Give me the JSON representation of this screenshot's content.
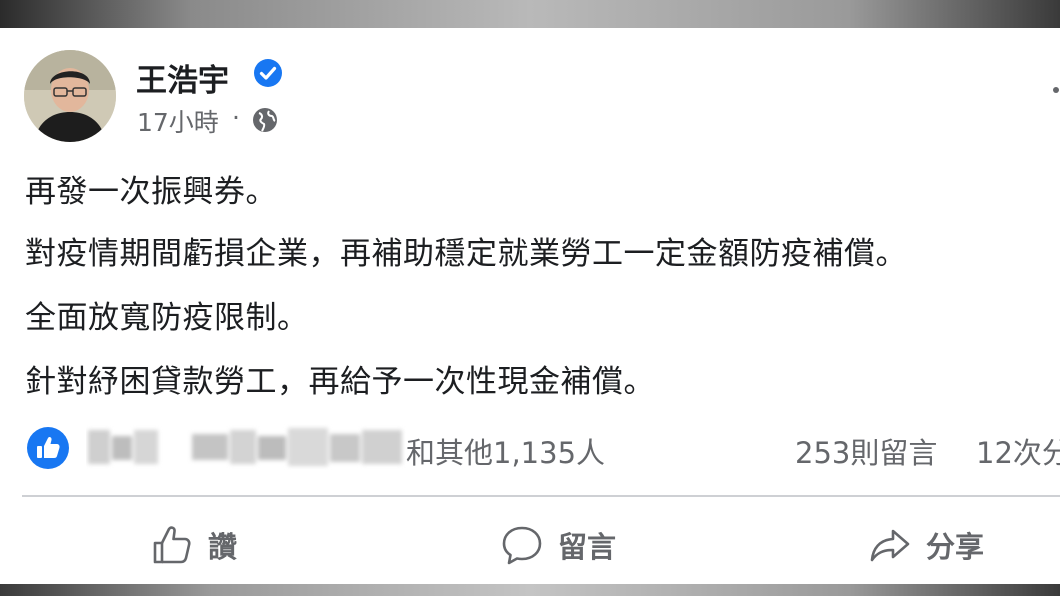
{
  "post": {
    "author": "王浩宇",
    "verified_icon": "verified-badge-icon",
    "timestamp": "17小時",
    "timestamp_separator": "·",
    "privacy_icon": "globe-icon",
    "lines": [
      "再發一次振興券。",
      "對疫情期間虧損企業，再補助穩定就業勞工一定金額防疫補償。",
      "全面放寬防疫限制。",
      "針對紓困貸款勞工，再給予一次性現金補償。"
    ]
  },
  "engagement": {
    "reaction_icon": "like-reaction-icon",
    "others_text": "和其他1,135人",
    "comments_text": "253則留言",
    "shares_text": "12次分"
  },
  "actions": {
    "like_label": "讚",
    "comment_label": "留言",
    "share_label": "分享"
  },
  "colors": {
    "facebook_blue": "#1877f2",
    "secondary_text": "#65676b",
    "primary_text": "#1c1e21",
    "divider": "#ced0d4"
  }
}
